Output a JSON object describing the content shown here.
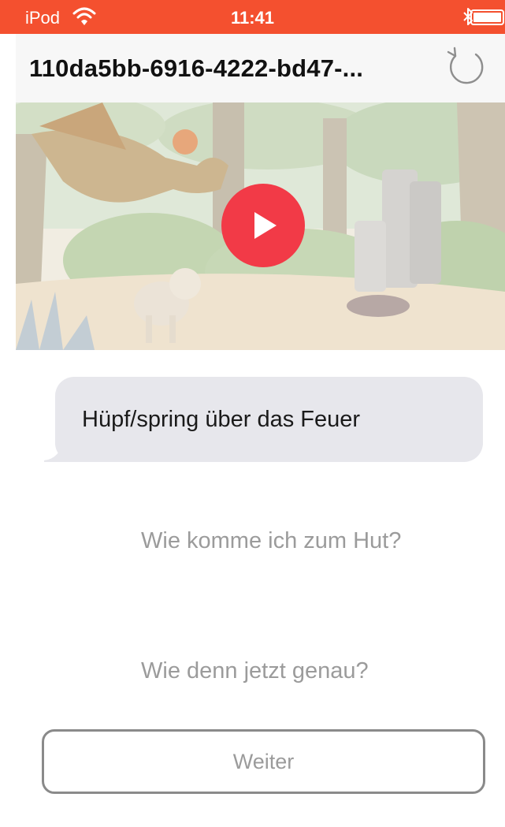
{
  "status_bar": {
    "carrier": "iPod",
    "time": "11:41",
    "wifi_icon": "wifi-icon",
    "bluetooth_icon": "bluetooth-icon",
    "battery_icon": "battery-icon",
    "background_color": "#f4502f"
  },
  "nav": {
    "title": "110da5bb-6916-4222-bd47-...",
    "reset_icon": "reset-icon"
  },
  "video": {
    "play_icon": "play-icon",
    "play_color": "#f23a47"
  },
  "message": {
    "text": "Hüpf/spring über das Feuer"
  },
  "options": [
    {
      "label": "Wie komme ich zum Hut?"
    },
    {
      "label": "Wie denn jetzt genau?"
    }
  ],
  "continue_button": {
    "label": "Weiter"
  }
}
